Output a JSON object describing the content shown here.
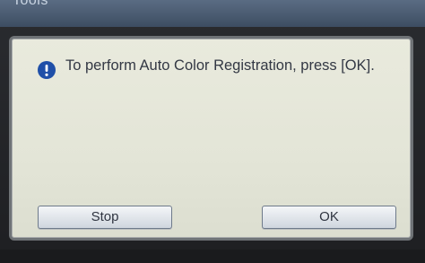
{
  "header": {
    "title": "Tools"
  },
  "dialog": {
    "icon": "info-icon",
    "message": "To perform Auto Color Registration, press [OK].",
    "buttons": {
      "stop_label": "Stop",
      "ok_label": "OK"
    }
  },
  "colors": {
    "title_bar": "#4a5b71",
    "dialog_background": "#e6e8da",
    "icon_blue": "#1f4fa8",
    "button_border": "#6e7a8a"
  }
}
